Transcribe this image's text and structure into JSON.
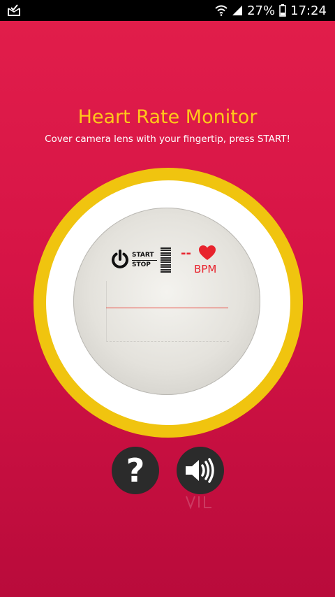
{
  "status_bar": {
    "battery_percent": "27%",
    "time": "17:24",
    "icons": [
      "mail-check-icon",
      "wifi-icon",
      "signal-icon",
      "battery-icon"
    ]
  },
  "header": {
    "title": "Heart Rate Monitor",
    "instruction": "Cover camera lens with your fingertip, press START!"
  },
  "dial": {
    "start_label": "START",
    "stop_label": "STOP",
    "bpm_value": "--",
    "bpm_unit": "BPM",
    "power_icon": "power-icon",
    "heart_icon": "heart-icon"
  },
  "controls": {
    "help_label": "?",
    "help_icon": "question-icon",
    "sound_icon": "speaker-icon"
  },
  "colors": {
    "background": "#d61446",
    "title": "#ffc81a",
    "ring": "#f0c40f",
    "accent_red": "#e8232d",
    "button": "#2b2b2b"
  }
}
